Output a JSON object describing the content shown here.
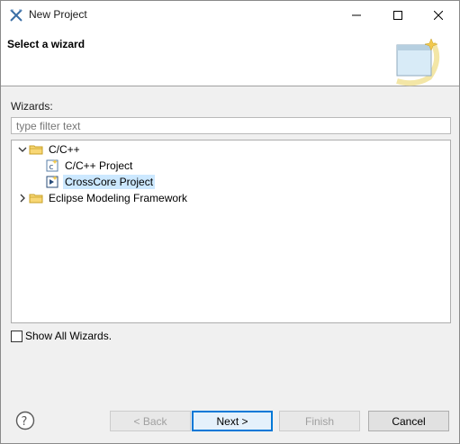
{
  "window": {
    "title": "New Project",
    "icon": "eclipse-x-icon"
  },
  "banner": {
    "title": "Select a wizard",
    "image": "wizard-banner-icon"
  },
  "wizards": {
    "label": "Wizards:",
    "filter_placeholder": "type filter text",
    "filter_value": ""
  },
  "tree": {
    "items": [
      {
        "label": "C/C++",
        "expanded": true,
        "icon": "folder-icon"
      },
      {
        "label": "C/C++ Project",
        "icon": "c-project-icon"
      },
      {
        "label": "CrossCore Project",
        "icon": "crosscore-project-icon",
        "selected": true
      },
      {
        "label": "Eclipse Modeling Framework",
        "expanded": false,
        "icon": "folder-icon"
      }
    ]
  },
  "show_all": {
    "label": "Show All Wizards.",
    "checked": false
  },
  "buttons": {
    "back": "< Back",
    "next": "Next >",
    "finish": "Finish",
    "cancel": "Cancel"
  }
}
